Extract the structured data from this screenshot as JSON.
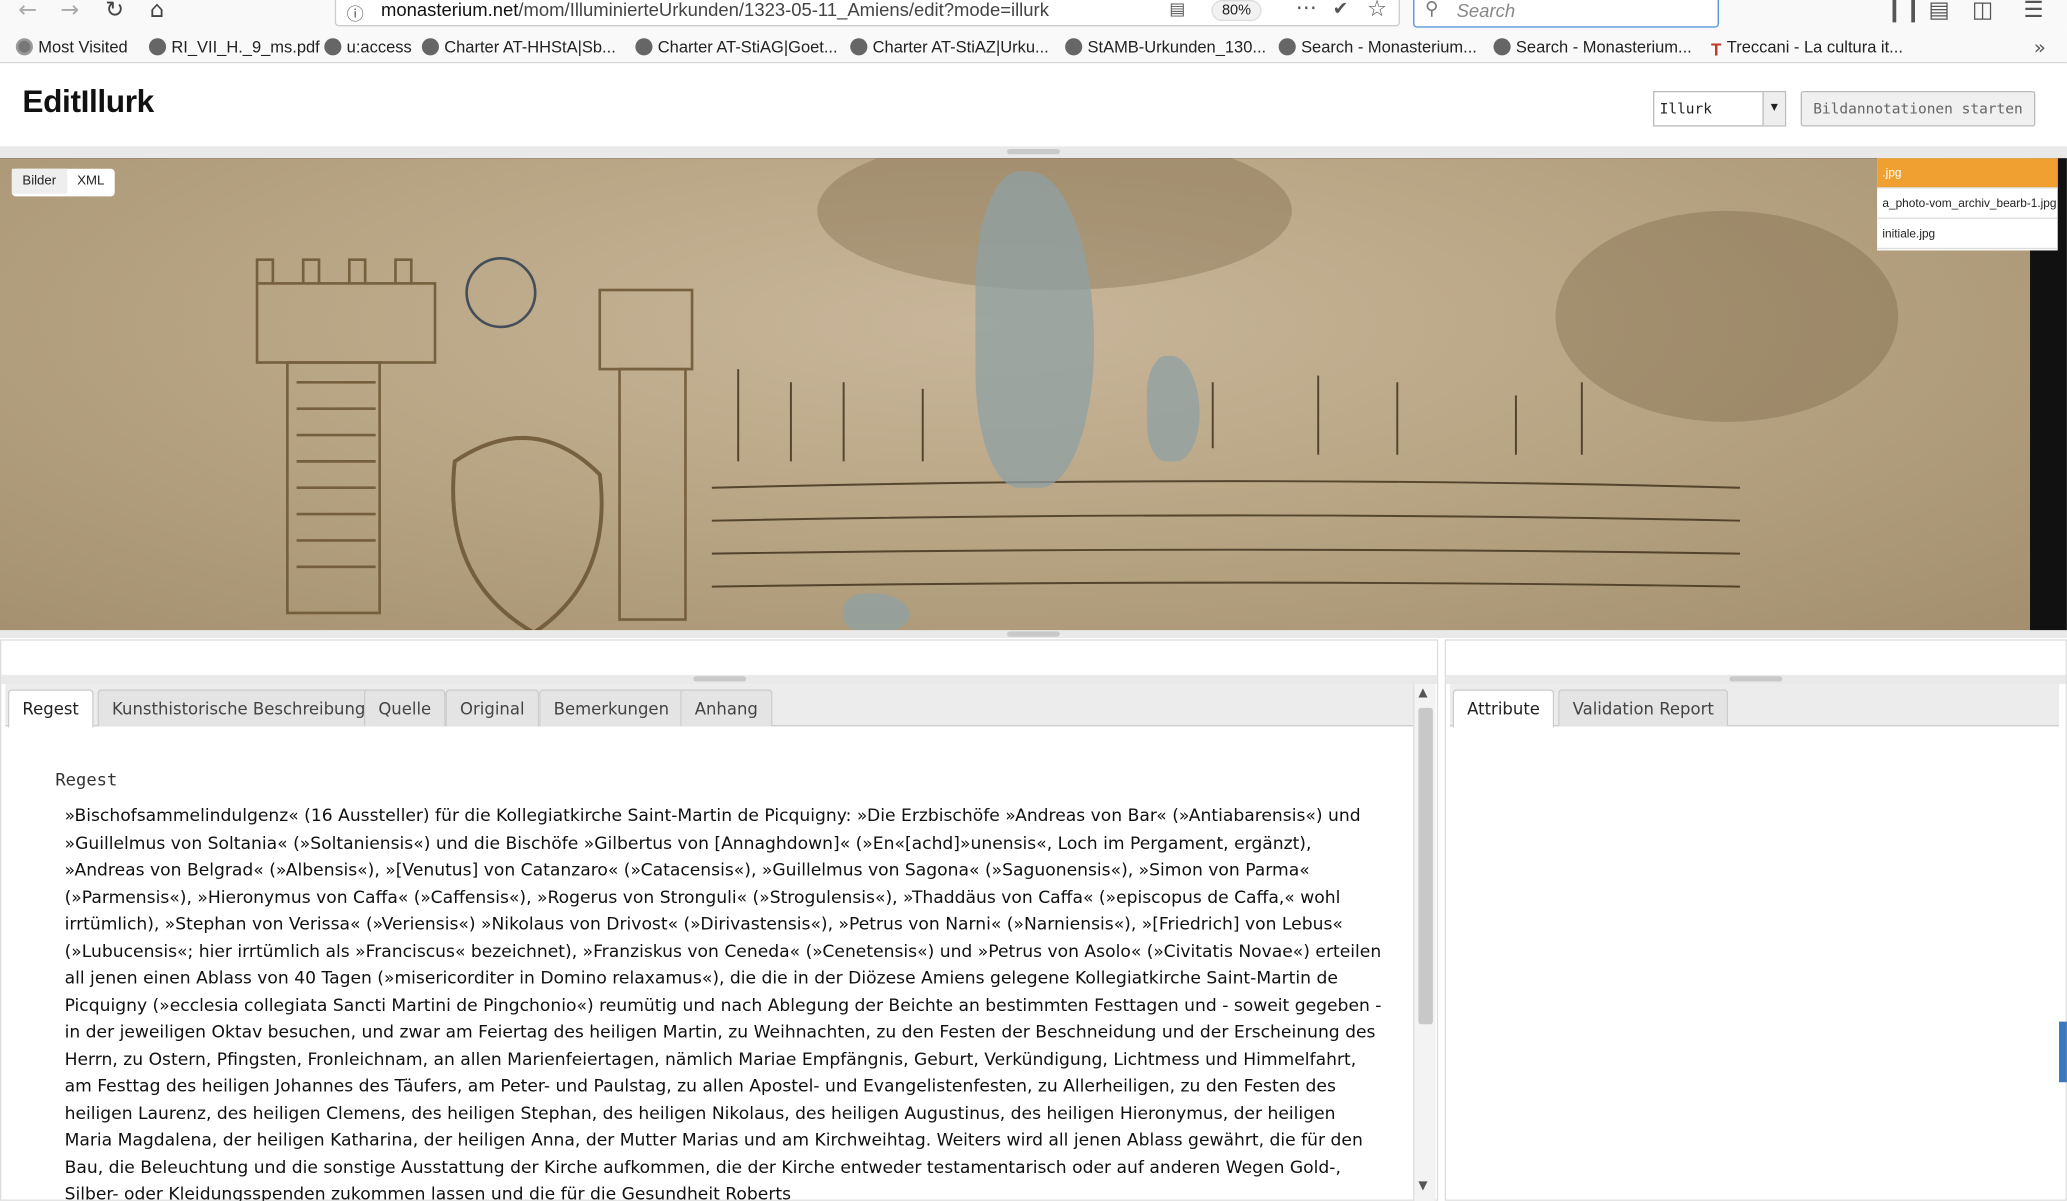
{
  "browser": {
    "url_host": "monasterium.net",
    "url_path": "/mom/IlluminierteUrkunden/1323-05-11_Amiens/edit?mode=illurk",
    "zoom": "80%",
    "search_placeholder": "Search"
  },
  "bookmarks": [
    {
      "label": "Most Visited",
      "icon": "gear-icon"
    },
    {
      "label": "RI_VII_H._9_ms.pdf",
      "icon": "globe-icon"
    },
    {
      "label": "u:access",
      "icon": "globe-icon"
    },
    {
      "label": "Charter AT-HHStA|Sb...",
      "icon": "globe-icon"
    },
    {
      "label": "Charter AT-StiAG|Goet...",
      "icon": "globe-icon"
    },
    {
      "label": "Charter AT-StiAZ|Urku...",
      "icon": "globe-icon"
    },
    {
      "label": "StAMB-Urkunden_130...",
      "icon": "globe-icon"
    },
    {
      "label": "Search - Monasterium...",
      "icon": "globe-icon"
    },
    {
      "label": "Search - Monasterium...",
      "icon": "globe-icon"
    },
    {
      "label": "Treccani - La cultura it...",
      "icon": "treccani-icon"
    }
  ],
  "page": {
    "title": "EditIllurk",
    "mode_value": "Illurk",
    "annot_button": "Bildannotationen starten"
  },
  "viewer": {
    "tabs": [
      "Bilder",
      "XML"
    ],
    "images": [
      ".jpg",
      "a_photo-vom_archiv_bearb-1.jpg",
      "initiale.jpg"
    ]
  },
  "left_tabs": [
    "Regest",
    "Kunsthistorische Beschreibung",
    "Quelle",
    "Original",
    "Bemerkungen",
    "Anhang"
  ],
  "right_tabs": [
    "Attribute",
    "Validation Report"
  ],
  "regest": {
    "heading": "Regest",
    "body": "»Bischofsammelindulgenz« (16 Aussteller) für die Kollegiatkirche Saint-Martin de Picquigny: »Die Erzbischöfe »Andreas von Bar« (»Antiabarensis«) und »Guillelmus von Soltania« (»Soltaniensis«) und die Bischöfe »Gilbertus von [Annaghdown]« (»En«[achd]»unensis«, Loch im Pergament, ergänzt), »Andreas von Belgrad« (»Albensis«), »[Venutus] von Catanzaro« (»Catacensis«), »Guillelmus von Sagona« (»Saguonensis«), »Simon von Parma« (»Parmensis«), »Hieronymus von Caffa« (»Caffensis«), »Rogerus von Stronguli« (»Strogulensis«), »Thaddäus von Caffa« (»episcopus de Caffa,« wohl irrtümlich), »Stephan von Verissa« (»Veriensis«) »Nikolaus von Drivost« (»Dirivastensis«), »Petrus von Narni« (»Narniensis«), »[Friedrich] von Lebus« (»Lubucensis«; hier irrtümlich als »Franciscus« bezeichnet), »Franziskus von Ceneda« (»Cenetensis«) und »Petrus von Asolo« (»Civitatis Novae«) erteilen all jenen einen Ablass von 40 Tagen (»misericorditer in Domino relaxamus«), die die in der Diözese Amiens gelegene Kollegiatkirche Saint-Martin de Picquigny (»ecclesia collegiata Sancti Martini de Pingchonio«) reumütig und nach Ablegung der Beichte an bestimmten Festtagen und - soweit gegeben - in der jeweiligen Oktav besuchen, und zwar am Feiertag des heiligen Martin, zu Weihnachten, zu den Festen der Beschneidung und der Erscheinung des Herrn, zu Ostern, Pfingsten, Fronleichnam, an allen Marienfeiertagen, nämlich Mariae Empfängnis, Geburt, Verkündigung, Lichtmess und Himmelfahrt, am Festtag des heiligen Johannes des Täufers, am Peter- und Paulstag, zu allen Apostel- und Evangelistenfesten, zu Allerheiligen, zu den Festen des heiligen Laurenz, des heiligen Clemens, des heiligen Stephan, des heiligen Nikolaus, des heiligen Augustinus, des heiligen Hieronymus, der heiligen Maria Magdalena, der heiligen Katharina, der heiligen Anna, der Mutter Marias und am Kirchweihtag. Weiters wird all jenen Ablass gewährt, die für den Bau, die Beleuchtung und die sonstige Ausstattung der Kirche aufkommen, die der Kirche entweder testamentarisch oder auf anderen Wegen Gold-, Silber- oder Kleidungsspenden zukommen lassen und die für die Gesundheit Roberts"
  }
}
